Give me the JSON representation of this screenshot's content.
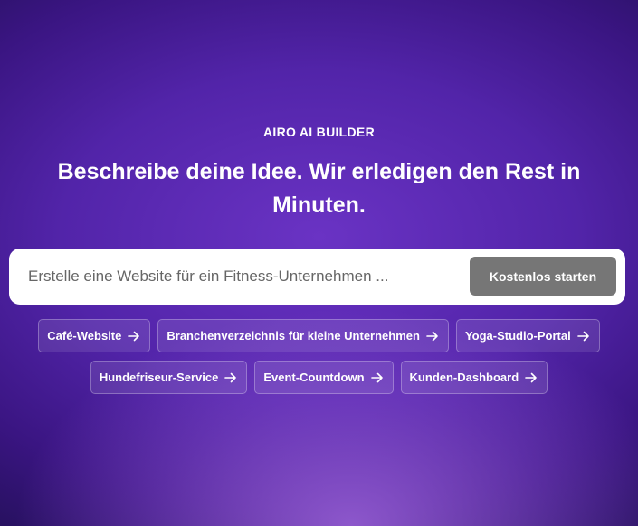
{
  "hero": {
    "eyebrow": "AIRO AI BUILDER",
    "headline": "Beschreibe deine Idee. Wir erledigen den Rest in Minuten."
  },
  "prompt": {
    "placeholder": "Erstelle eine Website für ein Fitness-Unternehmen ...",
    "value": "",
    "submit_label": "Kostenlos starten"
  },
  "suggestions": {
    "row1": [
      {
        "label": "Café-Website",
        "icon": "arrow-right-icon"
      },
      {
        "label": "Branchenverzeichnis für kleine Unternehmen",
        "icon": "arrow-right-icon"
      },
      {
        "label": "Yoga-Studio-Portal",
        "icon": "arrow-right-icon"
      }
    ],
    "row2": [
      {
        "label": "Hundefriseur-Service",
        "icon": "arrow-right-icon"
      },
      {
        "label": "Event-Countdown",
        "icon": "arrow-right-icon"
      },
      {
        "label": "Kunden-Dashboard",
        "icon": "arrow-right-icon"
      }
    ]
  },
  "colors": {
    "background_top": "#24105a",
    "background_mid": "#6a33c4",
    "background_glow": "#aa6ee6",
    "button_bg": "#767676",
    "input_bg": "#ffffff"
  }
}
